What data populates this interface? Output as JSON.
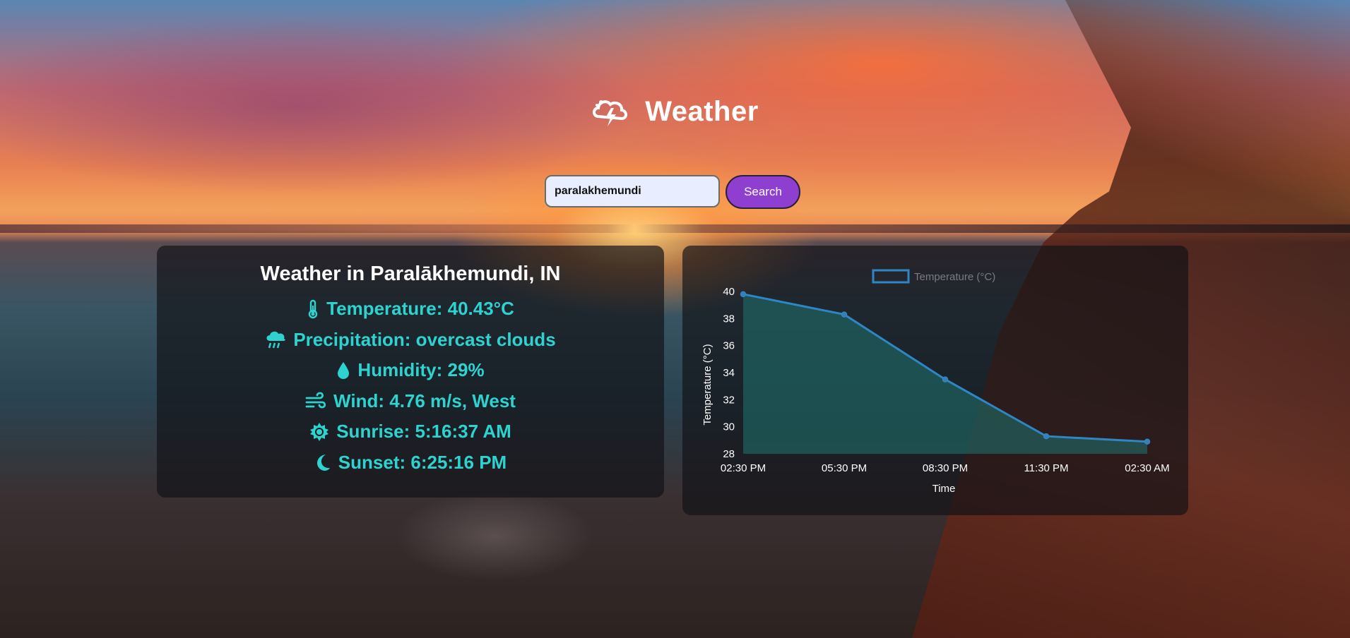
{
  "app": {
    "title": "Weather"
  },
  "search": {
    "value": "paralakhemundi",
    "button_label": "Search"
  },
  "weather": {
    "heading": "Weather in Paralākhemundi, IN",
    "rows": [
      {
        "icon": "thermometer-icon",
        "text": "Temperature: 40.43°C"
      },
      {
        "icon": "cloud-rain-icon",
        "text": "Precipitation: overcast clouds"
      },
      {
        "icon": "droplet-icon",
        "text": "Humidity: 29%"
      },
      {
        "icon": "wind-icon",
        "text": "Wind: 4.76 m/s, West"
      },
      {
        "icon": "sun-icon",
        "text": "Sunrise: 5:16:37 AM"
      },
      {
        "icon": "moon-icon",
        "text": "Sunset: 6:25:16 PM"
      }
    ]
  },
  "colors": {
    "accent": "#2ed3cf",
    "button": "#8f3fd0",
    "line": "#2f86c5",
    "fill": "#1f6e6a"
  },
  "chart_data": {
    "type": "line",
    "title": "",
    "legend": "Temperature (°C)",
    "legend_position": "top",
    "xlabel": "Time",
    "ylabel": "Temperature (°C)",
    "categories": [
      "02:30 PM",
      "05:30 PM",
      "08:30 PM",
      "11:30 PM",
      "02:30 AM"
    ],
    "series": [
      {
        "name": "Temperature (°C)",
        "values": [
          39.8,
          38.3,
          33.5,
          29.3,
          28.9
        ]
      }
    ],
    "ylim": [
      28,
      40
    ],
    "yticks": [
      40,
      38,
      36,
      34,
      32,
      30,
      28
    ],
    "fill": true,
    "grid": false
  }
}
